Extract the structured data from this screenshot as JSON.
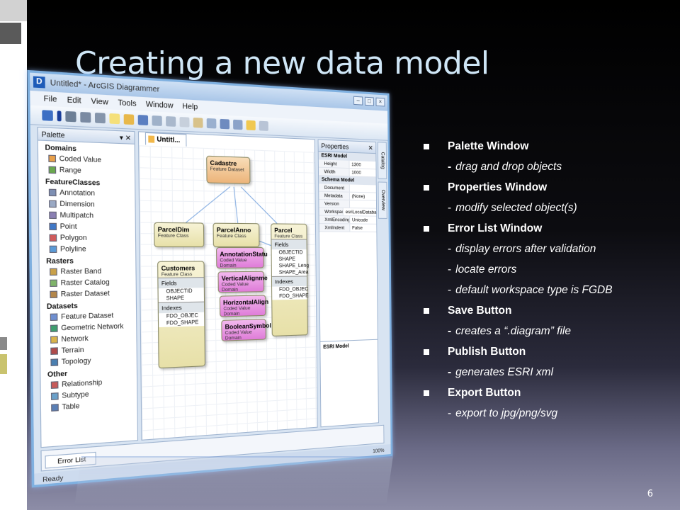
{
  "slide": {
    "title": "Creating a new data model",
    "page_number": "6"
  },
  "bullets": [
    {
      "head": "Palette Window",
      "subs": [
        {
          "dash": "-",
          "bold_dash": true,
          "text": "drag and drop objects"
        }
      ]
    },
    {
      "head": "Properties Window",
      "subs": [
        {
          "dash": "-",
          "bold_dash": false,
          "text": "modify selected object(s)"
        }
      ]
    },
    {
      "head": "Error List Window",
      "subs": [
        {
          "dash": "-",
          "bold_dash": false,
          "text": "display errors after validation"
        },
        {
          "dash": "-",
          "bold_dash": false,
          "text": "locate errors"
        },
        {
          "dash": "-",
          "bold_dash": false,
          "text": "default workspace type is FGDB"
        }
      ]
    },
    {
      "head": "Save Button",
      "subs": [
        {
          "dash": "-",
          "bold_dash": true,
          "text": "creates a “.diagram” file"
        }
      ]
    },
    {
      "head": "Publish Button",
      "subs": [
        {
          "dash": "-",
          "bold_dash": true,
          "text": "generates ESRI xml"
        }
      ]
    },
    {
      "head": "Export Button",
      "subs": [
        {
          "dash": "-",
          "bold_dash": false,
          "text": "export to jpg/png/svg"
        }
      ]
    }
  ],
  "app": {
    "window_title": "Untitled* - ArcGIS Diagrammer",
    "menu": [
      "File",
      "Edit",
      "View",
      "Tools",
      "Window",
      "Help"
    ],
    "palette": {
      "title": "Palette",
      "groups": [
        {
          "name": "Domains",
          "items": [
            "Coded Value",
            "Range"
          ]
        },
        {
          "name": "FeatureClasses",
          "items": [
            "Annotation",
            "Dimension",
            "Multipatch",
            "Point",
            "Polygon",
            "Polyline"
          ]
        },
        {
          "name": "Rasters",
          "items": [
            "Raster Band",
            "Raster Catalog",
            "Raster Dataset"
          ]
        },
        {
          "name": "Datasets",
          "items": [
            "Feature Dataset",
            "Geometric Network",
            "Network",
            "Terrain",
            "Topology"
          ]
        },
        {
          "name": "Other",
          "items": [
            "Relationship",
            "Subtype",
            "Table"
          ]
        }
      ]
    },
    "document_tab": "Untitl...",
    "diagram": {
      "cadastre": {
        "title": "Cadastre",
        "sub": "Feature Dataset"
      },
      "parceldim": {
        "title": "ParcelDim",
        "sub": "Feature Class"
      },
      "parcelanno": {
        "title": "ParcelAnno",
        "sub": "Feature Class"
      },
      "parcel": {
        "title": "Parcel",
        "sub": "Feature Class",
        "fields_label": "Fields",
        "fields": [
          "OBJECTID",
          "SHAPE",
          "SHAPE_Leng",
          "SHAPE_Area"
        ],
        "indexes_label": "Indexes",
        "indexes": [
          "FDO_OBJEC",
          "FDO_SHAPE"
        ]
      },
      "customers": {
        "title": "Customers",
        "sub": "Feature Class",
        "fields_label": "Fields",
        "fields": [
          "OBJECTID",
          "SHAPE"
        ],
        "indexes_label": "Indexes",
        "indexes": [
          "FDO_OBJEC",
          "FDO_SHAPE"
        ]
      },
      "domains": [
        {
          "title": "AnnotationStatu",
          "sub": "Coded Value Domain"
        },
        {
          "title": "VerticalAlignme",
          "sub": "Coded Value Domain"
        },
        {
          "title": "HorizontalAlign",
          "sub": "Coded Value Domain"
        },
        {
          "title": "BooleanSymbol",
          "sub": "Coded Value Domain"
        }
      ]
    },
    "properties": {
      "title": "Properties",
      "group1": "ESRI Model",
      "rows1": [
        {
          "k": "Height",
          "v": "1300"
        },
        {
          "k": "Width",
          "v": "1000"
        }
      ],
      "group2": "Schema Model",
      "rows2": [
        {
          "k": "Document",
          "v": ""
        },
        {
          "k": "Metadata",
          "v": "(None)"
        },
        {
          "k": "Version",
          "v": ""
        },
        {
          "k": "WorkspaceTyp",
          "v": "esriLocalDatabaseWo"
        },
        {
          "k": "XmlEncoding",
          "v": "Unicode"
        },
        {
          "k": "XmlIndent",
          "v": "False"
        }
      ],
      "footer": "ESRI Model"
    },
    "side_tabs": [
      "Catalog",
      "Overview"
    ],
    "error_tab": "Error List",
    "status": "Ready",
    "zoom": "100%"
  },
  "colors": {
    "title": "#cfe6f6",
    "accent": "#7fb0e0",
    "domain_fill": "#e58ee0",
    "class_fill": "#f1ecc2",
    "dataset_fill": "#f3c99a"
  }
}
